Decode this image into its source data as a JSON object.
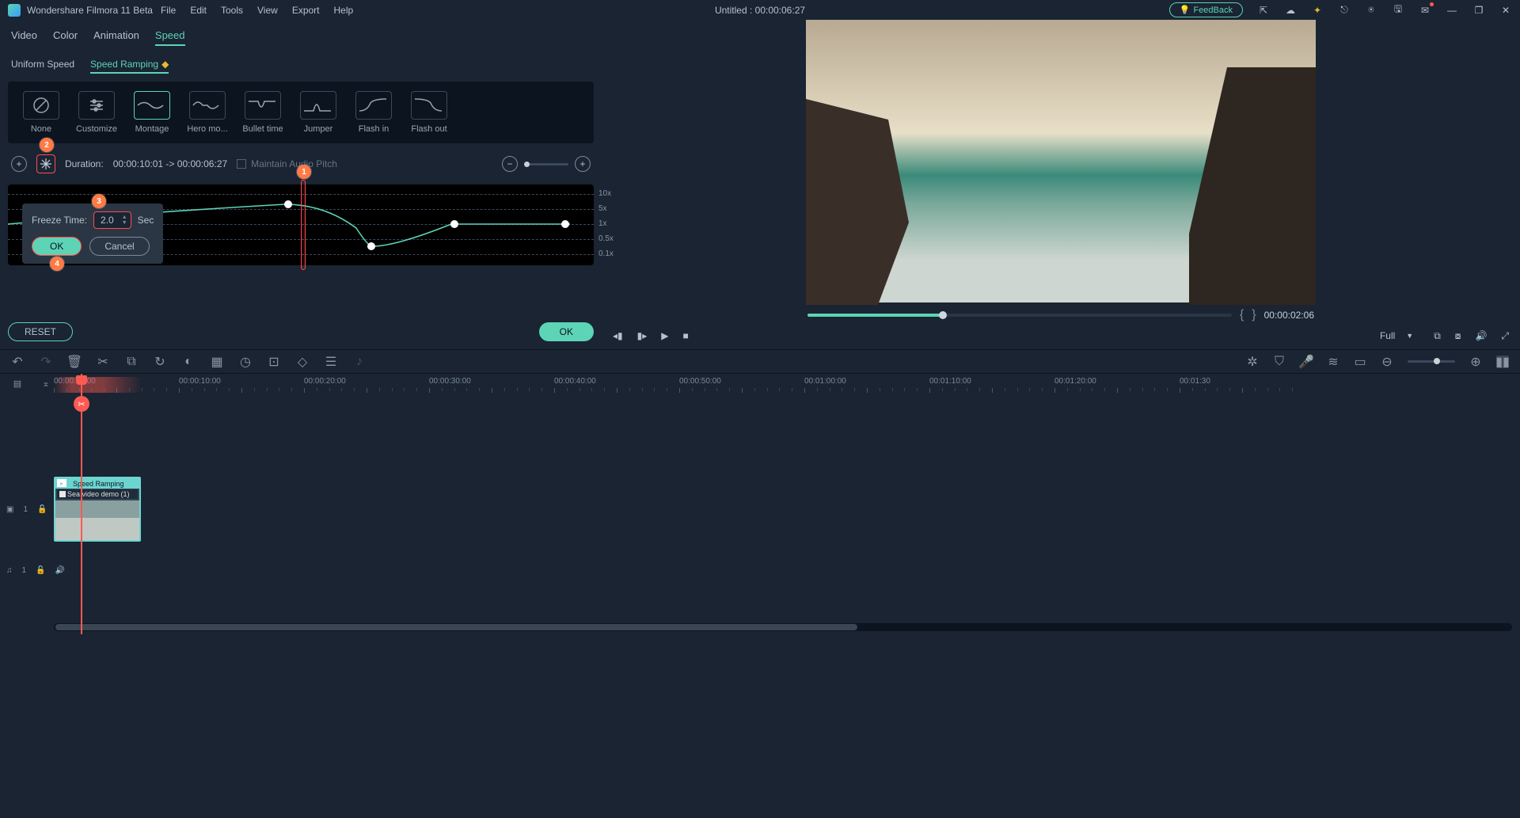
{
  "app": {
    "title": "Wondershare Filmora 11 Beta"
  },
  "menus": [
    "File",
    "Edit",
    "Tools",
    "View",
    "Export",
    "Help"
  ],
  "project": {
    "title": "Untitled : 00:00:06:27"
  },
  "feedback": {
    "label": "FeedBack"
  },
  "panel_tabs": {
    "video": "Video",
    "color": "Color",
    "animation": "Animation",
    "speed": "Speed"
  },
  "speed_subtabs": {
    "uniform": "Uniform Speed",
    "ramp": "Speed Ramping"
  },
  "presets": {
    "none": "None",
    "customize": "Customize",
    "montage": "Montage",
    "hero": "Hero mo...",
    "bullet": "Bullet time",
    "jumper": "Jumper",
    "flashin": "Flash in",
    "flashout": "Flash out"
  },
  "speed_info": {
    "duration_label": "Duration:",
    "duration_value": "00:00:10:01 -> 00:00:06:27",
    "maintain": "Maintain Audio Pitch"
  },
  "ramp_scale": {
    "s10": "10x",
    "s5": "5x",
    "s1": "1x",
    "s05": "0.5x",
    "s01": "0.1x"
  },
  "popover": {
    "label": "Freeze Time:",
    "value": "2.0",
    "unit": "Sec",
    "ok": "OK",
    "cancel": "Cancel"
  },
  "badges": {
    "b1": "1",
    "b2": "2",
    "b3": "3",
    "b4": "4"
  },
  "panel_footer": {
    "reset": "RESET",
    "ok": "OK"
  },
  "preview": {
    "time": "00:00:02:06",
    "progress_pct": 32,
    "quality": "Full"
  },
  "timeline": {
    "labels": [
      "00:00:00:00",
      "00:00:10:00",
      "00:00:20:00",
      "00:00:30:00",
      "00:00:40:00",
      "00:00:50:00",
      "00:01:00:00",
      "00:01:10:00",
      "00:01:20:00",
      "00:01:30"
    ],
    "video_track": "1",
    "audio_track": "1",
    "clip": {
      "badge": "Speed Ramping",
      "name": "Sea video demo (1)"
    }
  }
}
